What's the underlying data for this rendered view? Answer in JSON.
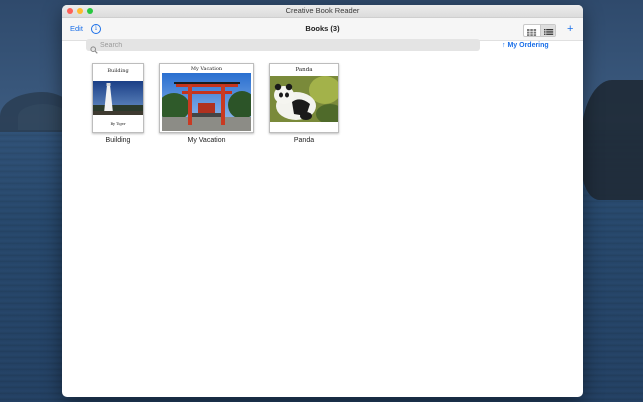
{
  "window": {
    "title": "Creative Book Reader"
  },
  "toolbar": {
    "edit_label": "Edit",
    "info_symbol": "i",
    "title": "Books (3)",
    "add_label": "+"
  },
  "search": {
    "placeholder": "Search",
    "value": ""
  },
  "ordering": {
    "label": "My Ordering",
    "arrow": "↑"
  },
  "books": [
    {
      "label": "Building",
      "cover_title": "Building",
      "cover_caption": "By Tiger"
    },
    {
      "label": "My Vacation",
      "cover_title": "My Vacation"
    },
    {
      "label": "Panda",
      "cover_title": "Panda"
    }
  ],
  "colors": {
    "accent": "#1a6fe8",
    "window_bg": "#ffffff",
    "search_bg": "#e4e4e4"
  },
  "icons": [
    "close-light",
    "minimize-light",
    "maximize-light",
    "info-icon",
    "grid-view-icon",
    "list-view-icon",
    "plus-icon",
    "search-icon",
    "up-arrow-icon"
  ]
}
